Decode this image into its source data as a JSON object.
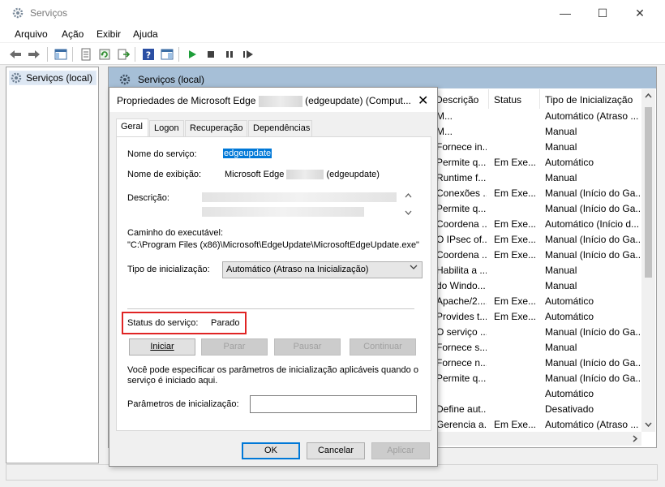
{
  "window": {
    "title": "Serviços",
    "minimize": "—",
    "maximize": "☐",
    "close": "✕"
  },
  "menu": {
    "file": "Arquivo",
    "action": "Ação",
    "view": "Exibir",
    "help": "Ajuda"
  },
  "tree": {
    "item": "Serviços (local)"
  },
  "panel": {
    "header": "Serviços (local)"
  },
  "table": {
    "headers": {
      "description": "Descrição",
      "status": "Status",
      "startup": "Tipo de Inicialização"
    },
    "rows": [
      {
        "description": "M...",
        "status": "",
        "startup": "Automático (Atraso ..."
      },
      {
        "description": "M...",
        "status": "",
        "startup": "Manual"
      },
      {
        "description": "Fornece in...",
        "status": "",
        "startup": "Manual"
      },
      {
        "description": "Permite q...",
        "status": "Em Exe...",
        "startup": "Automático"
      },
      {
        "description": "Runtime f...",
        "status": "",
        "startup": "Manual"
      },
      {
        "description": "Conexões ...",
        "status": "Em Exe...",
        "startup": "Manual (Início do Ga..."
      },
      {
        "description": "Permite q...",
        "status": "",
        "startup": "Manual (Início do Ga..."
      },
      {
        "description": "Coordena ...",
        "status": "Em Exe...",
        "startup": "Automático (Início d..."
      },
      {
        "description": "O IPsec of...",
        "status": "Em Exe...",
        "startup": "Manual (Início do Ga..."
      },
      {
        "description": "Coordena ...",
        "status": "Em Exe...",
        "startup": "Manual (Início do Ga..."
      },
      {
        "description": "Habilita a ...",
        "status": "",
        "startup": "Manual"
      },
      {
        "description": "do Windo...",
        "status": "",
        "startup": "Manual"
      },
      {
        "description": "Apache/2....",
        "status": "Em Exe...",
        "startup": "Automático"
      },
      {
        "description": "Provides t...",
        "status": "Em Exe...",
        "startup": "Automático"
      },
      {
        "description": "O serviço ...",
        "status": "",
        "startup": "Manual (Início do Ga..."
      },
      {
        "description": "Fornece s...",
        "status": "",
        "startup": "Manual"
      },
      {
        "description": "Fornece n...",
        "status": "",
        "startup": "Manual (Início do Ga..."
      },
      {
        "description": "Permite q...",
        "status": "",
        "startup": "Manual (Início do Ga..."
      },
      {
        "description": "",
        "status": "",
        "startup": "Automático"
      },
      {
        "description": "Define aut...",
        "status": "",
        "startup": "Desativado"
      },
      {
        "description": "Gerencia a...",
        "status": "Em Exe...",
        "startup": "Automático (Atraso ..."
      }
    ]
  },
  "dialog": {
    "title_prefix": "Propriedades de  Microsoft Edge",
    "title_suffix": "(edgeupdate) (Comput...",
    "close": "✕",
    "tabs": [
      "Geral",
      "Logon",
      "Recuperação",
      "Dependências"
    ],
    "service_name_label": "Nome do serviço:",
    "service_name_value": "edgeupdate",
    "display_name_label": "Nome de exibição:",
    "display_name_prefix": "Microsoft Edge",
    "display_name_suffix": "(edgeupdate)",
    "description_label": "Descrição:",
    "exe_path_label": "Caminho do executável:",
    "exe_path_value": "\"C:\\Program Files (x86)\\Microsoft\\EdgeUpdate\\MicrosoftEdgeUpdate.exe\"",
    "startup_type_label": "Tipo de inicialização:",
    "startup_type_value": "Automático (Atraso na Inicialização)",
    "status_label": "Status do serviço:",
    "status_value": "Parado",
    "start_button": "Iniciar",
    "stop_button": "Parar",
    "pause_button": "Pausar",
    "resume_button": "Continuar",
    "hint_text_1": "Você pode especificar os parâmetros de inicialização aplicáveis quando o",
    "hint_text_2": "serviço é iniciado aqui.",
    "params_label": "Parâmetros de inicialização:",
    "params_value": "",
    "ok_button": "OK",
    "cancel_button": "Cancelar",
    "apply_button": "Aplicar"
  },
  "colors": {
    "accent": "#0078d7",
    "header_bar": "#a6bfd7",
    "highlight_box": "#e02424",
    "play_green": "#1e9e3a"
  }
}
